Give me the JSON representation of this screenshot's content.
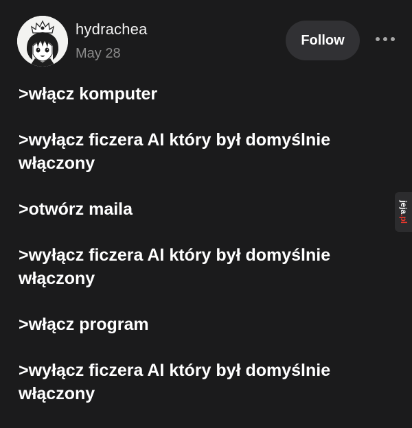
{
  "post": {
    "author": {
      "username": "hydrachea",
      "date": "May 28"
    },
    "actions": {
      "follow_label": "Follow",
      "more_icon": "more-horizontal-icon"
    },
    "lines": [
      ">włącz komputer",
      ">wyłącz ficzera AI który był domyślnie\nwłączony",
      ">otwórz maila",
      ">wyłącz ficzera AI który był domyślnie\nwłączony",
      ">włącz program",
      ">wyłącz ficzera AI który był domyślnie\nwłączony"
    ]
  },
  "watermark": {
    "name": "jeja",
    "suffix": ".pl"
  },
  "colors": {
    "background": "#1b1b1c",
    "text": "#ffffff",
    "muted": "#8c8c8c",
    "button": "#313134",
    "watermark_accent": "#e8382d"
  }
}
